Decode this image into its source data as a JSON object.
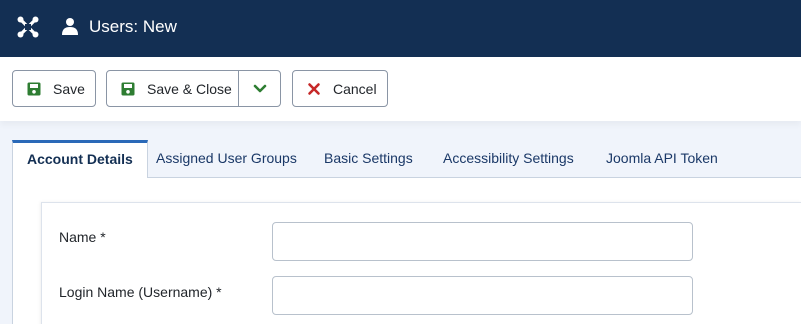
{
  "header": {
    "title": "Users: New",
    "logo_icon": "joomla-logo",
    "title_icon": "user-icon",
    "background": "#132f53"
  },
  "toolbar": {
    "save_label": "Save",
    "save_close_label": "Save & Close",
    "cancel_label": "Cancel",
    "save_icon": "floppy-disk-icon",
    "cancel_icon": "x-icon",
    "dropdown_icon": "chevron-down-icon",
    "save_icon_color": "#2e7d32",
    "cancel_icon_color": "#c62828"
  },
  "tabs": [
    {
      "label": "Account Details",
      "active": true
    },
    {
      "label": "Assigned User Groups",
      "active": false
    },
    {
      "label": "Basic Settings",
      "active": false
    },
    {
      "label": "Accessibility Settings",
      "active": false
    },
    {
      "label": "Joomla API Token",
      "active": false
    }
  ],
  "form": {
    "fields": [
      {
        "label": "Name *",
        "value": ""
      },
      {
        "label": "Login Name (Username) *",
        "value": ""
      }
    ]
  }
}
